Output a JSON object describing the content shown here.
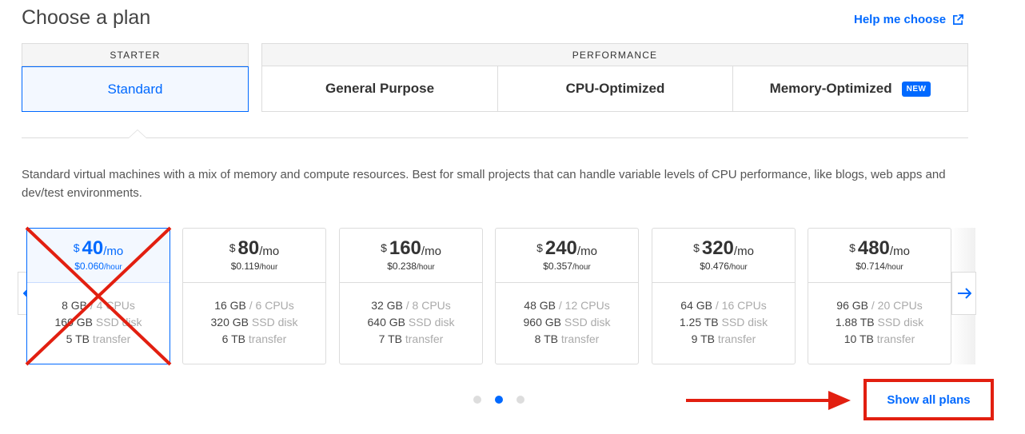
{
  "header": {
    "title": "Choose a plan",
    "help_label": "Help me choose"
  },
  "groups": {
    "starter": "STARTER",
    "performance": "PERFORMANCE"
  },
  "tabs": {
    "standard": "Standard",
    "general": "General Purpose",
    "cpu": "CPU-Optimized",
    "memory": "Memory-Optimized",
    "new_badge": "NEW"
  },
  "description": "Standard virtual machines with a mix of memory and compute resources. Best for small projects that can handle variable levels of CPU performance, like blogs, web apps and dev/test environments.",
  "plans": [
    {
      "currency": "$",
      "amount": "40",
      "per_month": "/mo",
      "hourly": "$0.060",
      "per_hour": "/hour",
      "mem": "8 GB",
      "cpus": "/ 4 CPUs",
      "disk": "160 GB",
      "disk_label": "SSD disk",
      "transfer": "5 TB",
      "transfer_label": "transfer",
      "selected": true
    },
    {
      "currency": "$",
      "amount": "80",
      "per_month": "/mo",
      "hourly": "$0.119",
      "per_hour": "/hour",
      "mem": "16 GB",
      "cpus": "/ 6 CPUs",
      "disk": "320 GB",
      "disk_label": "SSD disk",
      "transfer": "6 TB",
      "transfer_label": "transfer"
    },
    {
      "currency": "$",
      "amount": "160",
      "per_month": "/mo",
      "hourly": "$0.238",
      "per_hour": "/hour",
      "mem": "32 GB",
      "cpus": "/ 8 CPUs",
      "disk": "640 GB",
      "disk_label": "SSD disk",
      "transfer": "7 TB",
      "transfer_label": "transfer"
    },
    {
      "currency": "$",
      "amount": "240",
      "per_month": "/mo",
      "hourly": "$0.357",
      "per_hour": "/hour",
      "mem": "48 GB",
      "cpus": "/ 12 CPUs",
      "disk": "960 GB",
      "disk_label": "SSD disk",
      "transfer": "8 TB",
      "transfer_label": "transfer"
    },
    {
      "currency": "$",
      "amount": "320",
      "per_month": "/mo",
      "hourly": "$0.476",
      "per_hour": "/hour",
      "mem": "64 GB",
      "cpus": "/ 16 CPUs",
      "disk": "1.25 TB",
      "disk_label": "SSD disk",
      "transfer": "9 TB",
      "transfer_label": "transfer"
    },
    {
      "currency": "$",
      "amount": "480",
      "per_month": "/mo",
      "hourly": "$0.714",
      "per_hour": "/hour",
      "mem": "96 GB",
      "cpus": "/ 20 CPUs",
      "disk": "1.88 TB",
      "disk_label": "SSD disk",
      "transfer": "10 TB",
      "transfer_label": "transfer"
    }
  ],
  "carousel": {
    "active_page": 2,
    "pages": 3,
    "prev_icon": "arrow-left-icon",
    "next_icon": "arrow-right-icon"
  },
  "footer": {
    "show_all_label": "Show all plans"
  },
  "colors": {
    "accent": "#0069ff",
    "annotation": "#e21f10"
  }
}
